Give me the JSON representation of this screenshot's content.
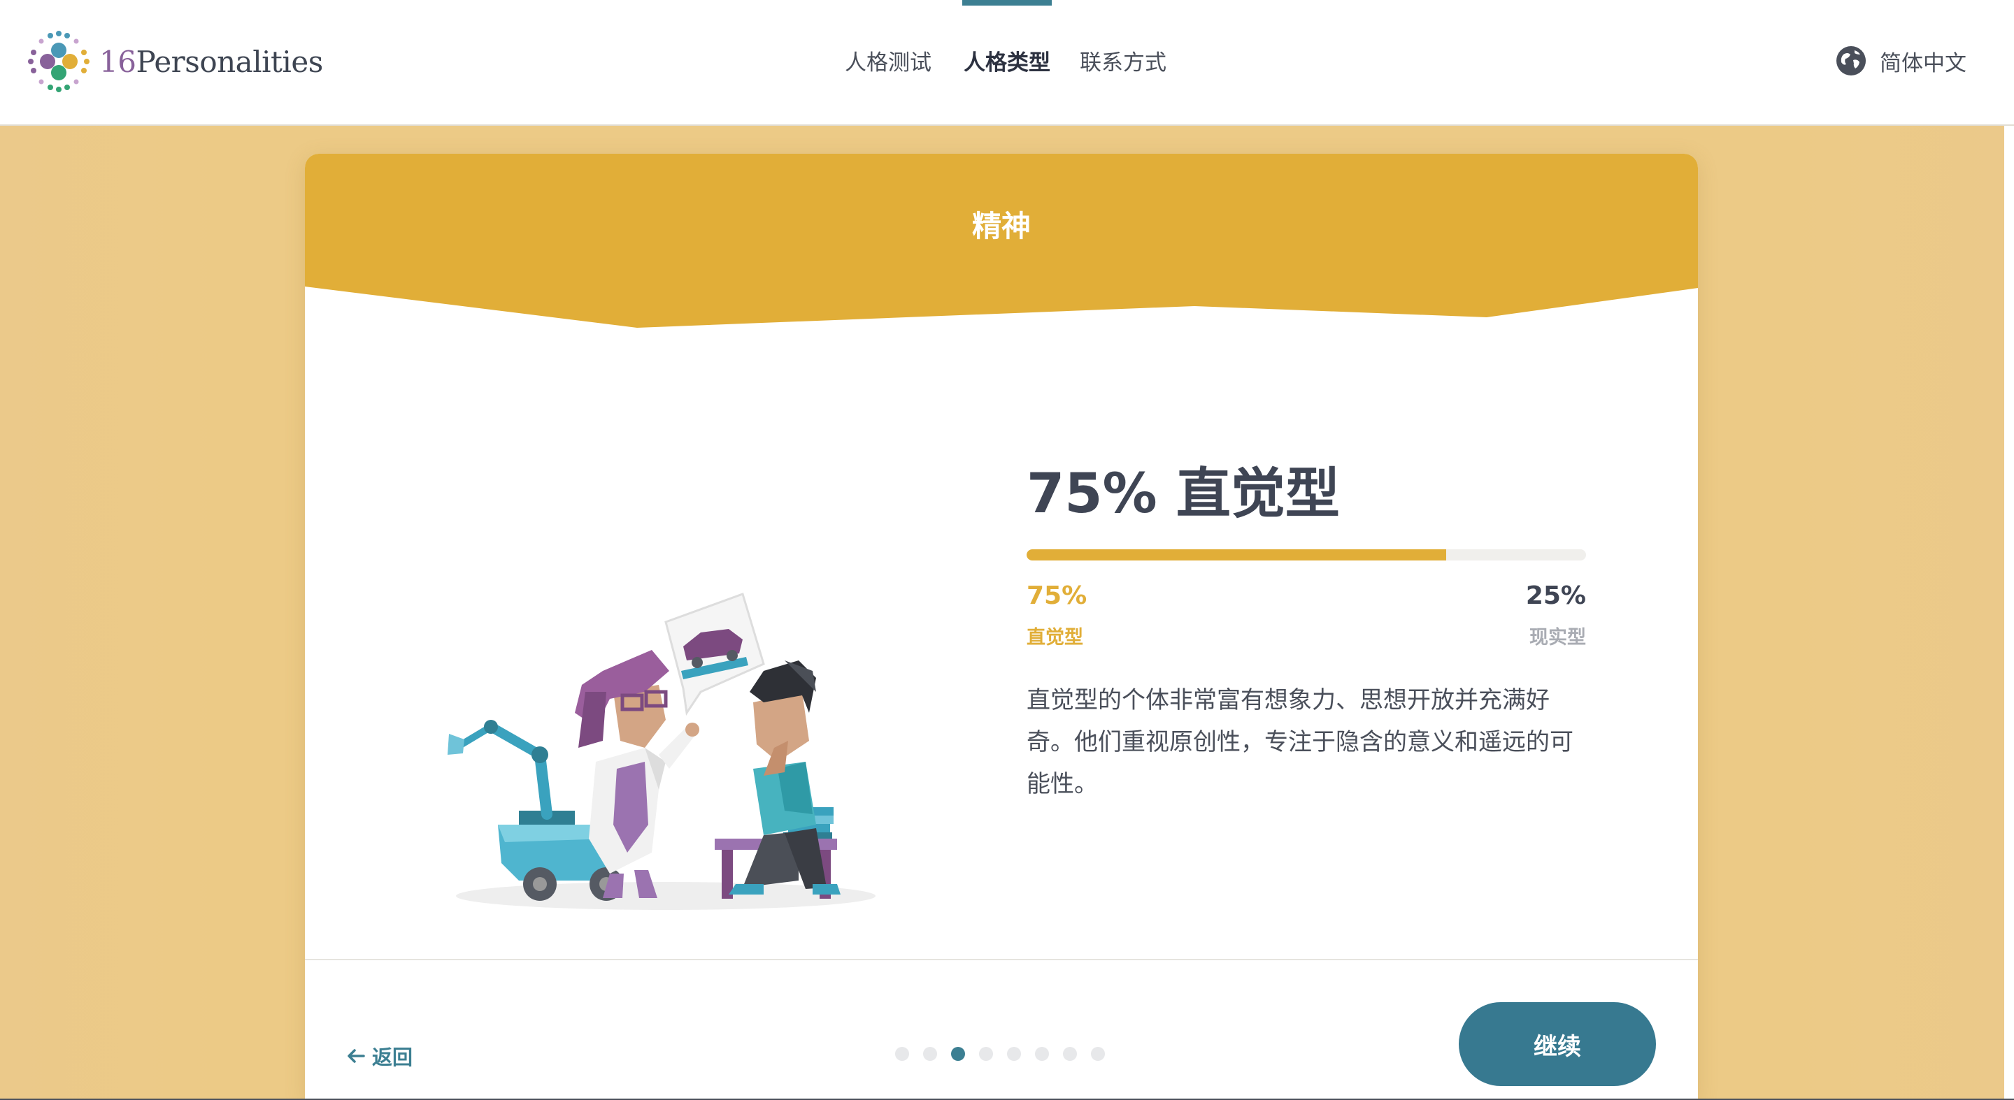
{
  "header": {
    "logo": {
      "number": "16",
      "word": "Personalities"
    },
    "nav": [
      {
        "label": "人格测试",
        "active": false
      },
      {
        "label": "人格类型",
        "active": true
      },
      {
        "label": "联系方式",
        "active": false
      }
    ],
    "language": {
      "label": "简体中文",
      "icon": "globe-icon"
    }
  },
  "card": {
    "title": "精神",
    "banner_color": "#e1ae38",
    "heading": "75% 直觉型",
    "bar": {
      "fill_percent": 75,
      "fill_color": "#e1ae38",
      "track_color": "#f0efec"
    },
    "left": {
      "percent": "75%",
      "label": "直觉型"
    },
    "right": {
      "percent": "25%",
      "label": "现实型"
    },
    "description": "直觉型的个体非常富有想象力、思想开放并充满好奇。他们重视原创性，专注于隐含的意义和遥远的可能性。",
    "illustration": "scientists-with-robot-arm-illustration"
  },
  "footer": {
    "back_label": "返回",
    "back_icon": "arrow-left-icon",
    "pagination": {
      "total": 8,
      "current": 3
    },
    "continue_label": "继续",
    "accent": "#377990"
  }
}
